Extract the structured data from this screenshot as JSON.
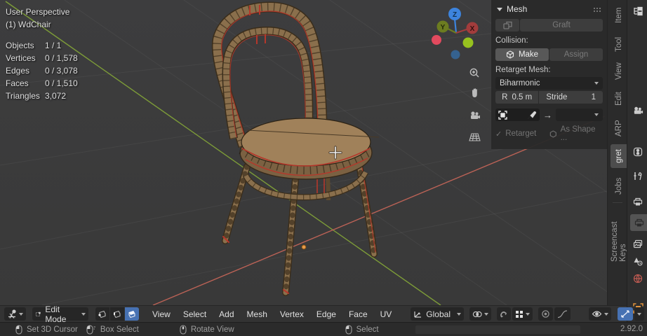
{
  "app": "Blender 3D Viewport",
  "viewport": {
    "overlay": {
      "view_name": "User Perspective",
      "object_name": "(1) WdChair"
    },
    "stats": [
      {
        "label": "Objects",
        "value": "1 / 1"
      },
      {
        "label": "Vertices",
        "value": "0 / 1,578"
      },
      {
        "label": "Edges",
        "value": "0 / 3,078"
      },
      {
        "label": "Faces",
        "value": "0 / 1,510"
      },
      {
        "label": "Triangles",
        "value": "3,072"
      }
    ],
    "gizmo_axes": {
      "x": "X",
      "y": "Y",
      "z": "Z"
    },
    "scene_object": "wooden bentwood chair in edit mode (wireframe + red seams)"
  },
  "npanel": {
    "title": "Mesh",
    "graft_label": "Graft",
    "collision_label": "Collision:",
    "make_label": "Make",
    "assign_label": "Assign",
    "retarget_mesh_label": "Retarget Mesh:",
    "method_value": "Biharmonic",
    "radius_label": "R",
    "radius_value": "0.5 m",
    "stride_label": "Stride",
    "stride_value": "1",
    "arrow_glyph": "→",
    "check_glyph": "✓",
    "retarget_label": "Retarget",
    "as_shape_label": "As Shape ..."
  },
  "tabs": {
    "active": "gret",
    "items": [
      "Item",
      "Tool",
      "View",
      "Edit",
      "ARP",
      "gret",
      "Jobs",
      "Screencast Keys"
    ]
  },
  "header": {
    "mode": "Edit Mode",
    "menus": [
      "View",
      "Select",
      "Add",
      "Mesh",
      "Vertex",
      "Edge",
      "Face",
      "UV"
    ],
    "orientation": "Global"
  },
  "statusbar": {
    "hints": [
      {
        "label": "Set 3D Cursor"
      },
      {
        "label": "Box Select"
      },
      {
        "label": "Rotate View"
      },
      {
        "label": "Select"
      }
    ],
    "version": "2.92.0"
  },
  "icons": {
    "editor-type-icon": "3d-viewport axis glyph",
    "mode-icon": "vertex-select square",
    "vertex-select-icon": "cube with vertex dot",
    "edge-select-icon": "cube with edge",
    "face-select-icon": "cube with filled face",
    "orientation-icon": "global axes",
    "pivot-icon": "two linked circles",
    "magnet-icon": "snap magnet",
    "snap-with-icon": "grid dots",
    "proportional-icon": "circle",
    "falloff-icon": "bell curve",
    "visibility-icon": "eye",
    "gizmo-icon": "crossed arrows (active blue)",
    "shading-icon": "shading sphere (clipped)",
    "zoom-icon": "magnifier plus",
    "pan-icon": "hand",
    "camera-view-icon": "camera",
    "ortho-grid-icon": "grid",
    "outliner-icon": "hierarchy tree",
    "render-icon": "camera back",
    "tool-icon": "screwdriver and wrench",
    "output-icon": "printer",
    "view-layer-icon": "stacked images",
    "scene-icon": "cone and ball",
    "world-icon": "red globe",
    "object-icon": "orange corner brackets",
    "mouse-lmb-icon": "left mouse button",
    "mouse-drag-icon": "left mouse drag",
    "mouse-mmb-icon": "middle mouse button"
  },
  "colors": {
    "accent_blue": "#4772b3",
    "axis_green": "#7d9c38",
    "axis_red": "#bc6256",
    "gizmo_z": "#3d84dd",
    "gizmo_y_pos": "#6c7c20",
    "gizmo_y_neg": "#97c21f",
    "gizmo_x_pos": "#a23c3c",
    "gizmo_x_neg": "#e24a5e",
    "gizmo_z_neg": "#35628f",
    "wood": "#8a6f4c",
    "seat_top": "#a0815a",
    "selected_seam_red": "#b5372b",
    "origin_orange": "#e79b48",
    "world_icon_red": "#c05b52",
    "object_icon_orange": "#e0923c"
  }
}
